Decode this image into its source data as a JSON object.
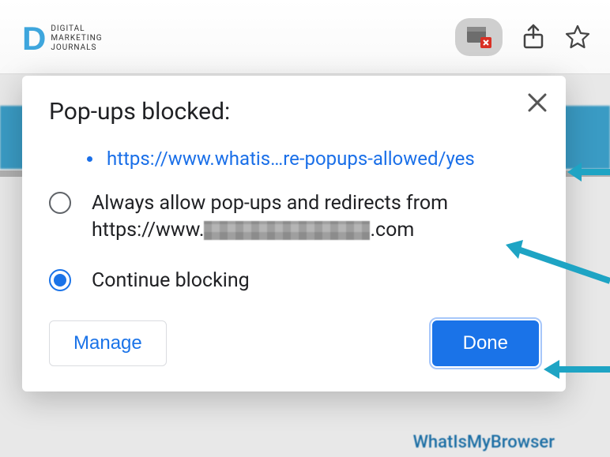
{
  "watermark": {
    "text": "DIGITAL\nMARKETING\nJOURNALS"
  },
  "toolbar": {
    "popup_blocked_icon": "popup-blocked",
    "share_icon": "share",
    "star_icon": "star"
  },
  "page_background": {
    "footer_hint": "WhatIsMyBrowser"
  },
  "dialog": {
    "title": "Pop-ups blocked:",
    "blocked_urls": [
      "https://www.whatis…re-popups-allowed/yes"
    ],
    "options": [
      {
        "id": "allow",
        "selected": false,
        "label_line1": "Always allow pop-ups and redirects from",
        "label_prefix": "https://www.",
        "label_suffix": ".com"
      },
      {
        "id": "block",
        "selected": true,
        "label": "Continue blocking"
      }
    ],
    "buttons": {
      "manage": "Manage",
      "done": "Done"
    }
  }
}
